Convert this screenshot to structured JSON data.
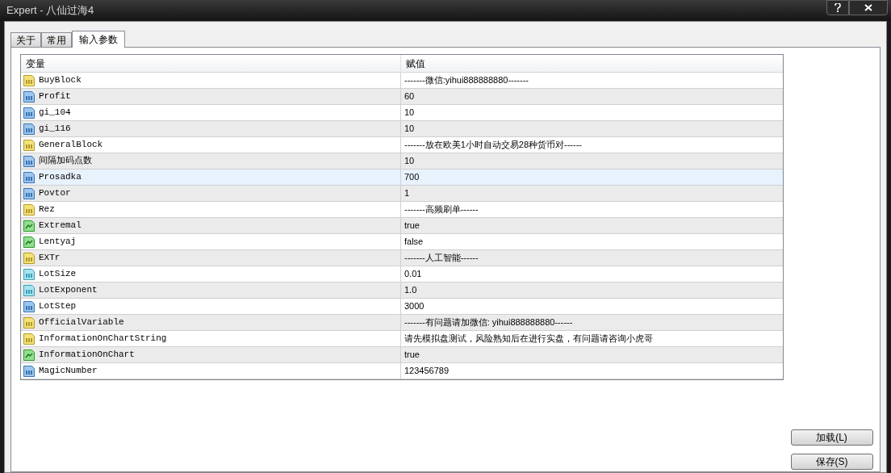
{
  "window": {
    "title": "Expert - 八仙过海4"
  },
  "tabs": [
    {
      "label": "关于",
      "selected": false
    },
    {
      "label": "常用",
      "selected": false
    },
    {
      "label": "输入参数",
      "selected": true
    }
  ],
  "table": {
    "columns": [
      "变量",
      "赋值"
    ],
    "rows": [
      {
        "kind": "string",
        "name": "BuyBlock",
        "value": "-------微信:yihui888888880-------",
        "selected": false
      },
      {
        "kind": "int",
        "name": "Profit",
        "value": "60",
        "selected": false
      },
      {
        "kind": "int",
        "name": "gi_104",
        "value": "10",
        "selected": false
      },
      {
        "kind": "int",
        "name": "gi_116",
        "value": "10",
        "selected": false
      },
      {
        "kind": "string",
        "name": "GeneralBlock",
        "value": "-------放在欧美1小时自动交易28种货币对------",
        "selected": false
      },
      {
        "kind": "int",
        "name": "间隔加码点数",
        "value": "10",
        "selected": false
      },
      {
        "kind": "int",
        "name": "Prosadka",
        "value": "700",
        "selected": true
      },
      {
        "kind": "int",
        "name": "Povtor",
        "value": "1",
        "selected": false
      },
      {
        "kind": "string",
        "name": "Rez",
        "value": "-------高频刷单------",
        "selected": false
      },
      {
        "kind": "bool",
        "name": "Extremal",
        "value": "true",
        "selected": false
      },
      {
        "kind": "bool",
        "name": "Lentyaj",
        "value": "false",
        "selected": false
      },
      {
        "kind": "string",
        "name": "EXTr",
        "value": "-------人工智能------",
        "selected": false
      },
      {
        "kind": "double",
        "name": "LotSize",
        "value": "0.01",
        "selected": false
      },
      {
        "kind": "double",
        "name": "LotExponent",
        "value": "1.0",
        "selected": false
      },
      {
        "kind": "int",
        "name": "LotStep",
        "value": "3000",
        "selected": false
      },
      {
        "kind": "string",
        "name": "OfficialVariable",
        "value": "-------有问题请加微信: yihui888888880------",
        "selected": false
      },
      {
        "kind": "string",
        "name": "InformationOnChartString",
        "value": "请先模拟盘测试，风险熟知后在进行实盘，有问题请咨询小虎哥",
        "selected": false
      },
      {
        "kind": "bool",
        "name": "InformationOnChart",
        "value": "true",
        "selected": false
      },
      {
        "kind": "int",
        "name": "MagicNumber",
        "value": "123456789",
        "selected": false
      }
    ]
  },
  "buttons": [
    "加载(L)",
    "保存(S)"
  ]
}
